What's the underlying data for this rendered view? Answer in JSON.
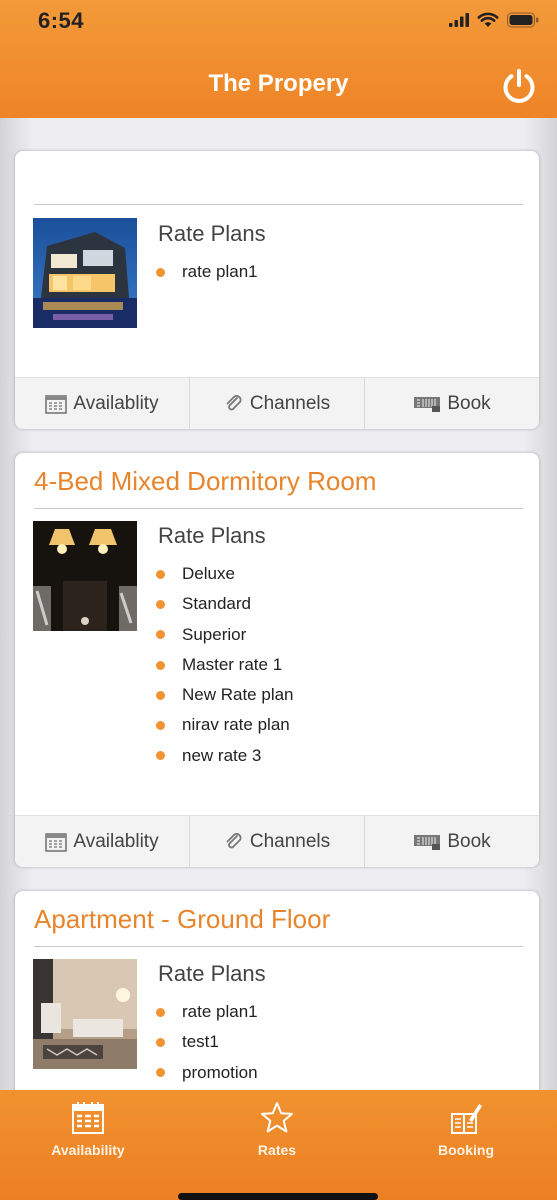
{
  "status_bar": {
    "time": "6:54"
  },
  "header": {
    "title": "The Propery",
    "power_icon": "power-icon"
  },
  "rooms": [
    {
      "title": "",
      "rate_plans_heading": "Rate Plans",
      "rate_plans": [
        "rate plan1"
      ],
      "image": "building-photo"
    },
    {
      "title": "4-Bed Mixed Dormitory Room",
      "rate_plans_heading": "Rate Plans",
      "rate_plans": [
        "Deluxe",
        "Standard",
        "Superior",
        "Master rate 1",
        "New Rate plan",
        "nirav rate plan",
        "new rate 3"
      ],
      "image": "lamps-photo"
    },
    {
      "title": "Apartment - Ground Floor",
      "rate_plans_heading": "Rate Plans",
      "rate_plans": [
        "rate plan1",
        "test1",
        "promotion"
      ],
      "image": "living-room-photo"
    }
  ],
  "card_actions": {
    "availability": "Availablity",
    "channels": "Channels",
    "book": "Book"
  },
  "tabbar": [
    {
      "label": "Availability",
      "icon": "calendar-icon"
    },
    {
      "label": "Rates",
      "icon": "star-icon"
    },
    {
      "label": "Booking",
      "icon": "book-pen-icon"
    }
  ],
  "colors": {
    "accent": "#ee8426",
    "title_orange": "#e8842b",
    "bullet": "#f39233"
  }
}
